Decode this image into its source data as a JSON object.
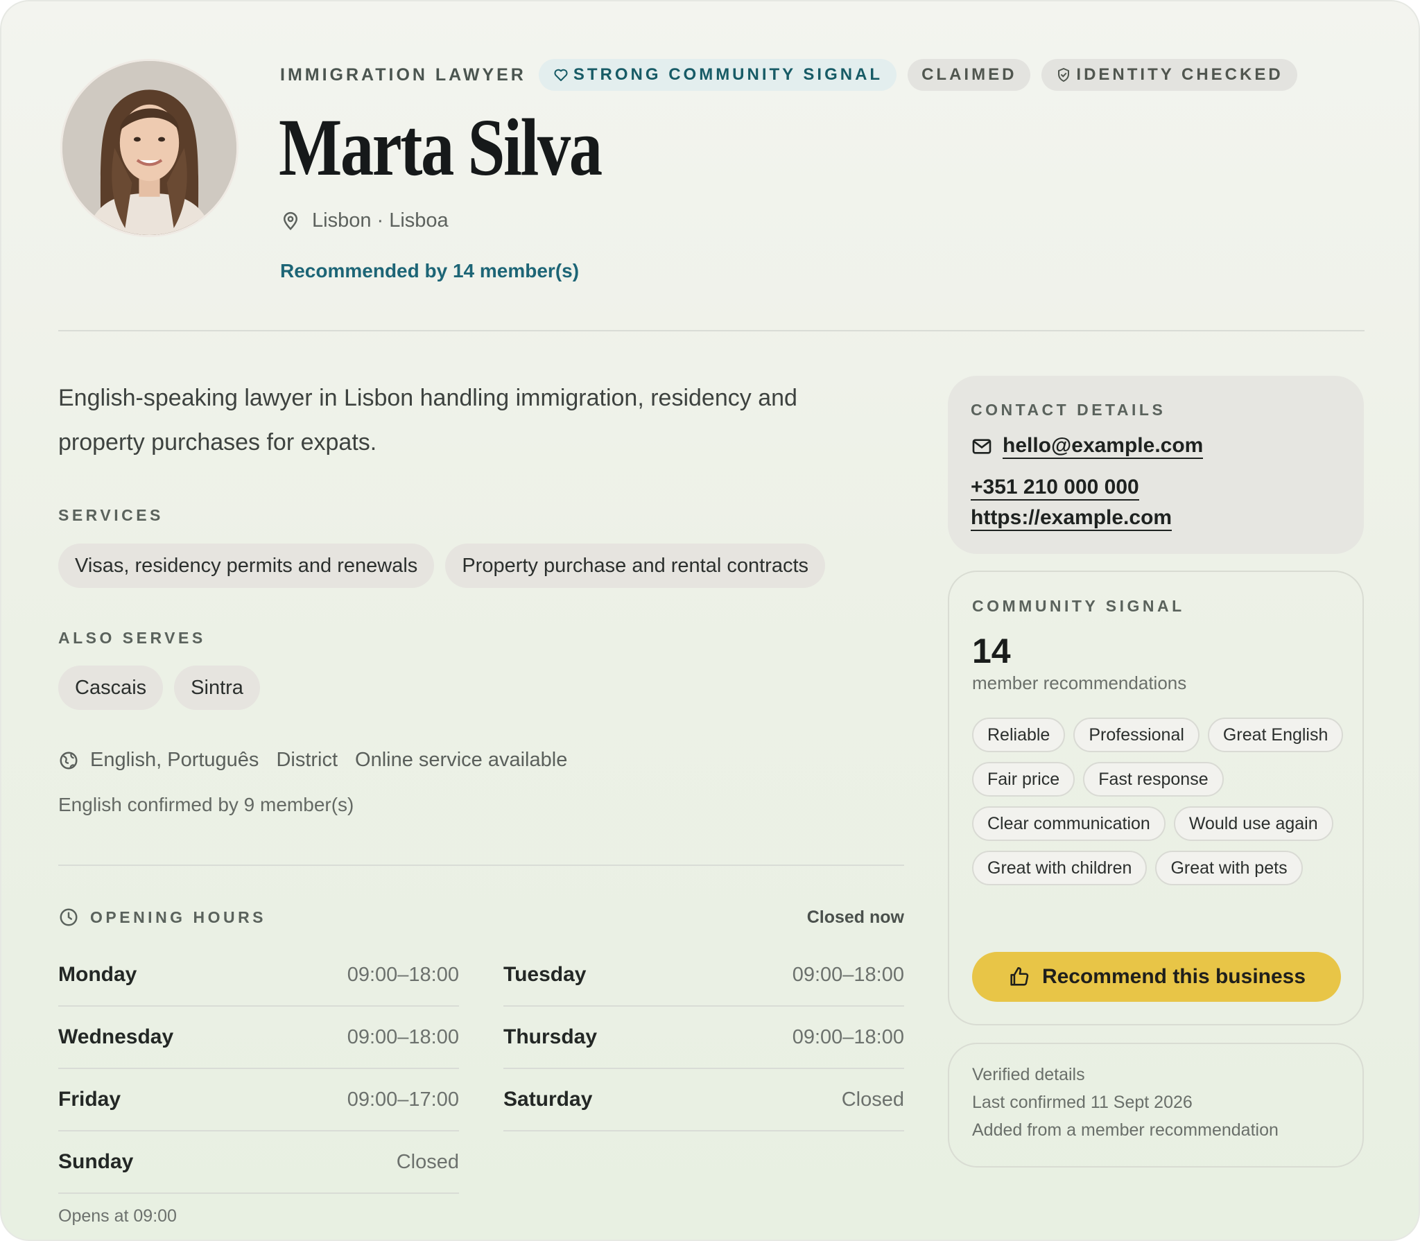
{
  "header": {
    "category": "IMMIGRATION LAWYER",
    "badges": {
      "strong": "STRONG COMMUNITY SIGNAL",
      "claimed": "CLAIMED",
      "identity": "IDENTITY CHECKED"
    },
    "name": "Marta Silva",
    "location": "Lisbon · Lisboa",
    "recommended": "Recommended by 14 member(s)"
  },
  "description": "English-speaking lawyer in Lisbon handling immigration, residency and property purchases for expats.",
  "services": {
    "label": "SERVICES",
    "items": [
      "Visas, residency permits and renewals",
      "Property purchase and rental contracts"
    ]
  },
  "also_serves": {
    "label": "ALSO SERVES",
    "items": [
      "Cascais",
      "Sintra"
    ]
  },
  "meta": {
    "languages": "English, Português",
    "scope": "District",
    "online": "Online service available",
    "english_confirmed": "English confirmed by 9 member(s)"
  },
  "hours": {
    "title": "OPENING HOURS",
    "status": "Closed now",
    "days": [
      {
        "day": "Monday",
        "time": "09:00–18:00"
      },
      {
        "day": "Tuesday",
        "time": "09:00–18:00"
      },
      {
        "day": "Wednesday",
        "time": "09:00–18:00"
      },
      {
        "day": "Thursday",
        "time": "09:00–18:00"
      },
      {
        "day": "Friday",
        "time": "09:00–17:00"
      },
      {
        "day": "Saturday",
        "time": "Closed"
      },
      {
        "day": "Sunday",
        "time": "Closed"
      }
    ],
    "opens_at": "Opens at 09:00"
  },
  "contact": {
    "label": "CONTACT DETAILS",
    "email": "hello@example.com",
    "phone": "+351 210 000 000",
    "website": "https://example.com"
  },
  "signal": {
    "label": "COMMUNITY SIGNAL",
    "count": "14",
    "sub": "member recommendations",
    "tags": [
      "Reliable",
      "Professional",
      "Great English",
      "Fair price",
      "Fast response",
      "Clear communication",
      "Would use again",
      "Great with children",
      "Great with pets"
    ],
    "button": "Recommend this business"
  },
  "verified": {
    "title": "Verified details",
    "last_confirmed": "Last confirmed 11 Sept 2026",
    "source": "Added from a member recommendation"
  },
  "colors": {
    "accent_teal": "#1d6576",
    "button_yellow": "#e8c547"
  }
}
